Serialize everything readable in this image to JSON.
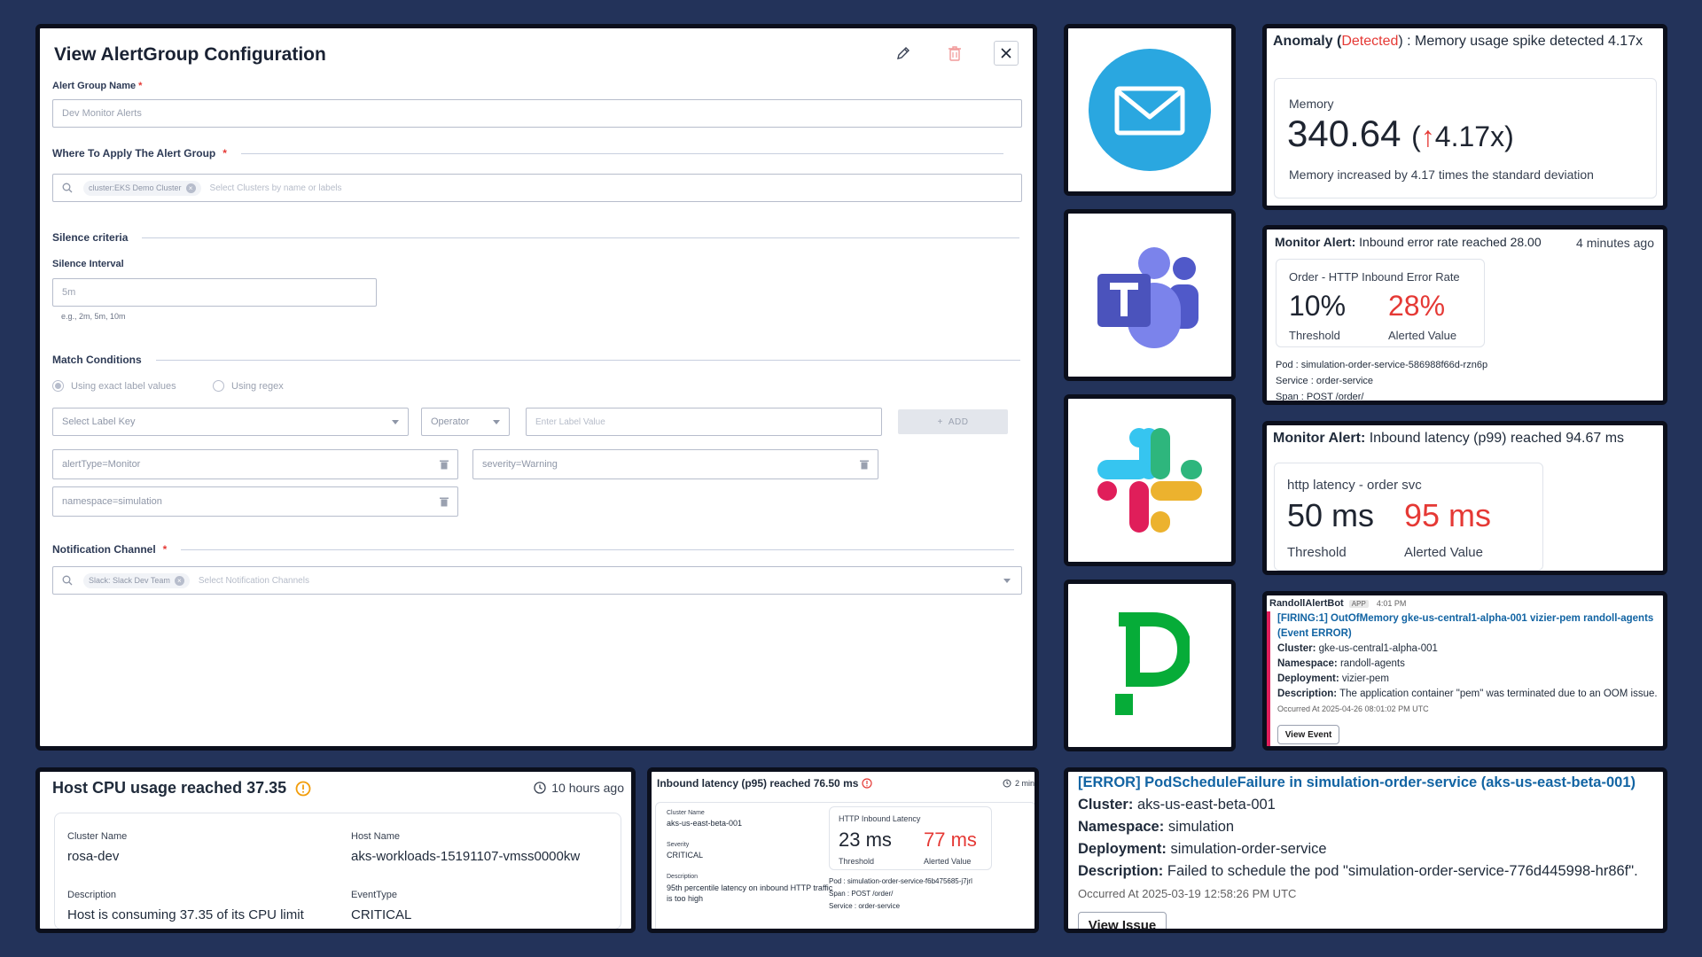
{
  "config": {
    "title": "View AlertGroup Configuration",
    "alert_group_name_label": "Alert Group Name",
    "alert_group_name_value": "Dev Monitor Alerts",
    "where_label": "Where To Apply The Alert Group",
    "cluster_chip": "cluster:EKS Demo Cluster",
    "cluster_placeholder": "Select Clusters by name or labels",
    "silence_section": "Silence criteria",
    "silence_interval_label": "Silence Interval",
    "silence_interval_value": "5m",
    "silence_hint": "e.g., 2m, 5m, 10m",
    "match_section": "Match Conditions",
    "radio_exact": "Using exact label values",
    "radio_regex": "Using regex",
    "label_key_placeholder": "Select Label Key",
    "operator_placeholder": "Operator",
    "label_value_placeholder": "Enter Label Value",
    "add_label": "ADD",
    "conditions": [
      "alertType=Monitor",
      "severity=Warning",
      "namespace=simulation"
    ],
    "notification_label": "Notification Channel",
    "notification_chip": "Slack: Slack Dev Team",
    "notification_placeholder": "Select Notification Channels"
  },
  "tiles": [
    "email-logo",
    "teams-logo",
    "slack-logo",
    "pagerduty-logo"
  ],
  "anomaly": {
    "prefix": "Anomaly (",
    "detected": "Detected",
    "suffix": ") : Memory usage spike detected 4.17x",
    "metric_name": "Memory",
    "value": "340.64",
    "open_paren": "(",
    "multiplier": "4.17x",
    "close_paren": ")",
    "description": "Memory increased by 4.17 times the standard deviation"
  },
  "error_rate": {
    "title_bold": "Monitor Alert:",
    "title_rest": "Inbound error rate reached 28.00",
    "time": "4 minutes ago",
    "metric": "Order - HTTP Inbound Error Rate",
    "threshold": "10%",
    "threshold_label": "Threshold",
    "alerted": "28%",
    "alerted_label": "Alerted Value",
    "pod": "Pod : simulation-order-service-586988f66d-rzn6p",
    "service": "Service : order-service",
    "span": "Span : POST /order/"
  },
  "latency99": {
    "title_bold": "Monitor Alert:",
    "title_rest": "Inbound latency (p99) reached 94.67 ms",
    "metric": "http latency - order svc",
    "threshold": "50 ms",
    "threshold_label": "Threshold",
    "alerted": "95 ms",
    "alerted_label": "Alerted Value"
  },
  "slack_msg": {
    "bot": "RandollAlertBot",
    "app_badge": "APP",
    "time": "4:01 PM",
    "link": "[FIRING:1] OutOfMemory gke-us-central1-alpha-001 vizier-pem randoll-agents (Event ERROR)",
    "cluster_k": "Cluster:",
    "cluster_v": "gke-us-central1-alpha-001",
    "ns_k": "Namespace:",
    "ns_v": "randoll-agents",
    "dep_k": "Deployment:",
    "dep_v": "vizier-pem",
    "desc_k": "Description:",
    "desc_v": "The application container \"pem\" was terminated due to an OOM issue.",
    "occurred": "Occurred At 2025-04-26 08:01:02 PM UTC",
    "button": "View Event"
  },
  "cpu": {
    "title": "Host CPU usage reached 37.35",
    "time": "10 hours ago",
    "cluster_label": "Cluster Name",
    "cluster_value": "rosa-dev",
    "host_label": "Host Name",
    "host_value": "aks-workloads-15191107-vmss0000kw",
    "desc_label": "Description",
    "desc_value": "Host is consuming 37.35 of its CPU limit",
    "type_label": "EventType",
    "type_value": "CRITICAL"
  },
  "latency95": {
    "title": "Inbound latency (p95) reached 76.50 ms",
    "time": "2 min",
    "cluster_label": "Cluster Name",
    "cluster_value": "aks-us-east-beta-001",
    "severity_label": "Severity",
    "severity_value": "CRITICAL",
    "desc_label": "Description",
    "desc_value": "95th percentile latency on inbound HTTP traffic is too high",
    "metric": "HTTP Inbound Latency",
    "threshold": "23 ms",
    "threshold_label": "Threshold",
    "alerted": "77 ms",
    "alerted_label": "Alerted Value",
    "pod": "Pod : simulation-order-service-f6b475685-j7jrl",
    "span": "Span : POST /order/",
    "service": "Service : order-service"
  },
  "podsched": {
    "title": "[ERROR] PodScheduleFailure in simulation-order-service (aks-us-east-beta-001)",
    "cluster_k": "Cluster:",
    "cluster_v": "aks-us-east-beta-001",
    "ns_k": "Namespace:",
    "ns_v": "simulation",
    "dep_k": "Deployment:",
    "dep_v": "simulation-order-service",
    "desc_k": "Description:",
    "desc_v": "Failed to schedule the pod \"simulation-order-service-776d445998-hr86f\".",
    "occurred": "Occurred At 2025-03-19 12:58:26 PM UTC",
    "button": "View Issue"
  },
  "colors": {
    "background": "#23335a",
    "border": "#0b0f1c",
    "alert_red": "#e53935",
    "slack_link": "#1264a3"
  }
}
